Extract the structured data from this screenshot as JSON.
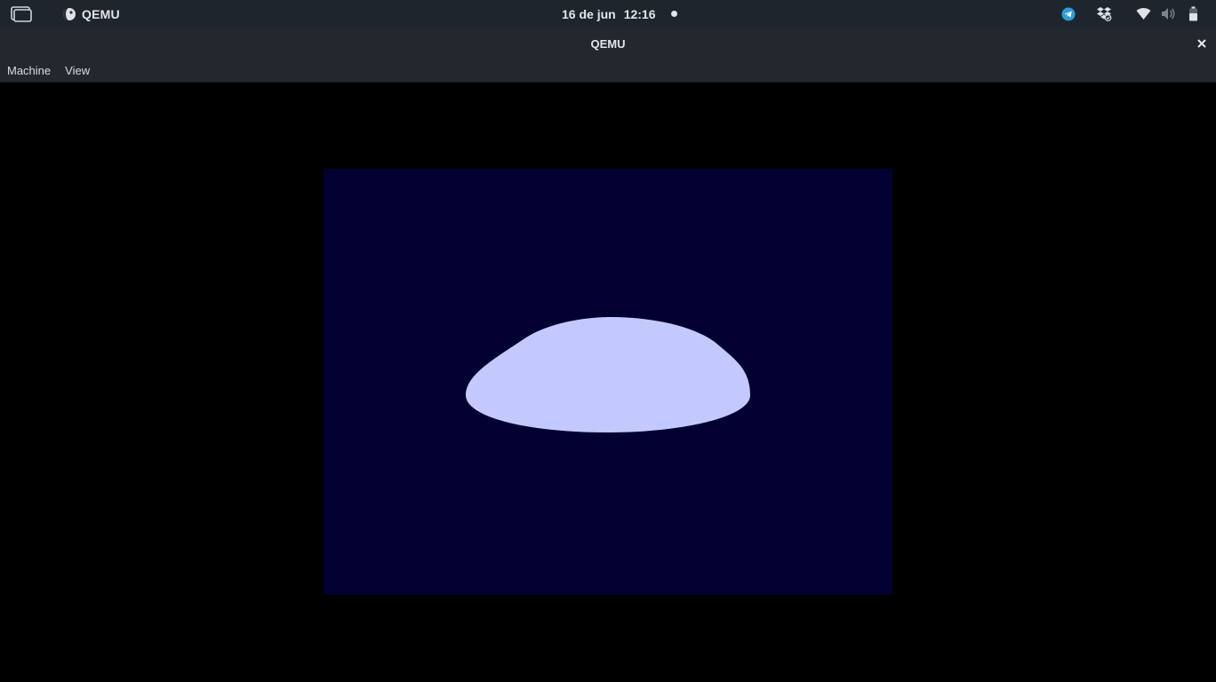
{
  "topbar": {
    "app_name": "QEMU",
    "clock_date": "16 de jun",
    "clock_time": "12:16",
    "icons": [
      "activities-icon",
      "qemu-app-icon",
      "telegram-icon",
      "dropbox-icon",
      "wifi-icon",
      "volume-icon",
      "battery-icon"
    ]
  },
  "window": {
    "title": "QEMU",
    "close_icon": "close-icon"
  },
  "menubar": {
    "items": [
      {
        "label": "Machine"
      },
      {
        "label": "View"
      }
    ]
  },
  "guest": {
    "background_color": "#020030",
    "shape_color": "#c3c9fc"
  },
  "colors": {
    "topbar_bg": "#1f252c",
    "titlebar_bg": "#22282e",
    "telegram_accent": "#2c9fd9"
  }
}
